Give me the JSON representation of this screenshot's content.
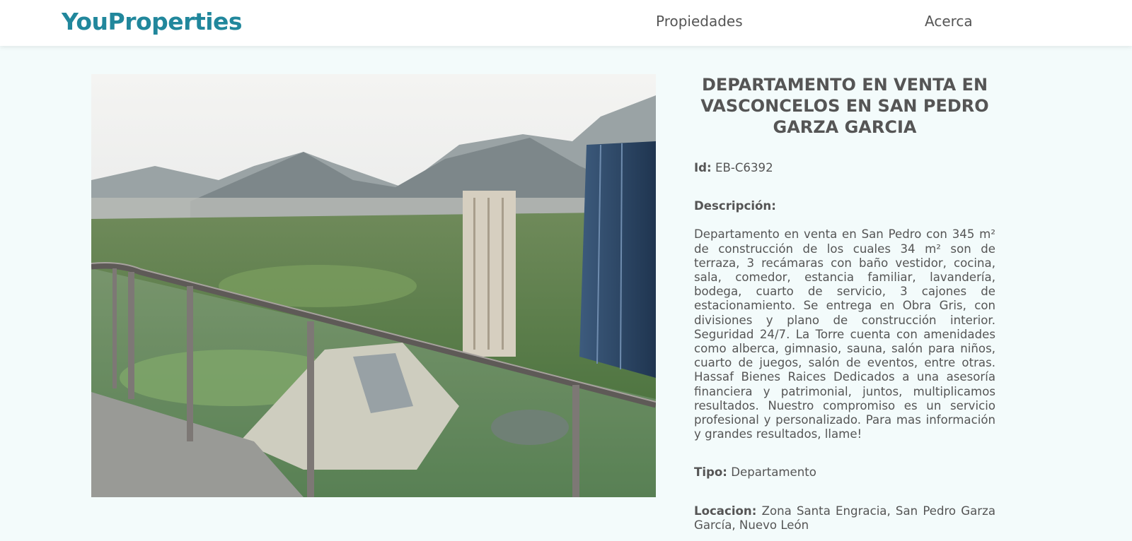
{
  "nav": {
    "brand": "YouProperties",
    "links": [
      "Propiedades",
      "Acerca"
    ]
  },
  "property": {
    "title": "DEPARTAMENTO EN VENTA EN VASCONCELOS EN SAN PEDRO GARZA GARCIA",
    "id_label": "Id:",
    "id_value": "EB-C6392",
    "description_label": "Descripción:",
    "description": "Departamento en venta en San Pedro con 345 m² de construcción de los cuales 34 m² son de terraza, 3 recámaras con baño vestidor, cocina, sala, comedor, estancia familiar, lavandería, bodega, cuarto de servicio, 3 cajones de estacionamiento. Se entrega en Obra Gris, con divisiones y plano de construcción interior. Seguridad 24/7. La Torre cuenta con amenidades como alberca, gimnasio, sauna, salón para niños, cuarto de juegos, salón de eventos, entre otras. Hassaf Bienes Raices Dedicados a una asesoría financiera y patrimonial, juntos, multiplicamos resultados. Nuestro compromiso es un servicio profesional y personalizado. Para mas información y grandes resultados, llame!",
    "type_label": "Tipo:",
    "type_value": "Departamento",
    "location_label": "Locacion:",
    "location_value": "Zona Santa Engracia, San Pedro Garza García, Nuevo León"
  },
  "colors": {
    "brand": "#21879c",
    "page_background": "#f3fbfb",
    "text": "#555555"
  }
}
